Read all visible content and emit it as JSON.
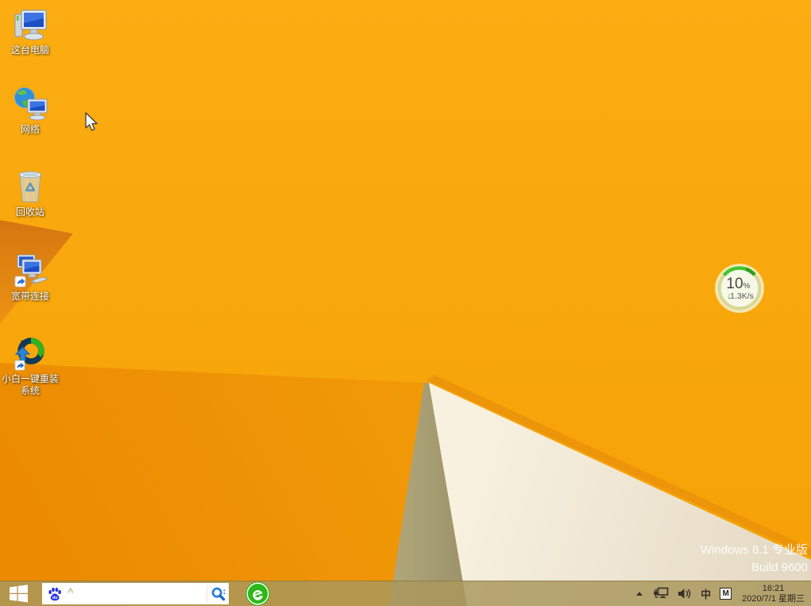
{
  "desktop": {
    "icons": [
      {
        "label": "这台电脑"
      },
      {
        "label": "网络"
      },
      {
        "label": "回收站"
      },
      {
        "label": "宽带连接"
      },
      {
        "label": "小白一键重装系统"
      }
    ],
    "watermark": {
      "line1": "Windows 8.1 专业版",
      "line2": "Build 9600"
    },
    "float_ball": {
      "percent": "10",
      "unit": "%",
      "down_arrow": "↓",
      "speed": "1.3K/s"
    }
  },
  "taskbar": {
    "search": {
      "caret": "^",
      "value": "",
      "placeholder": ""
    },
    "tray": {
      "ime_lang": "中",
      "ime_mode": "M",
      "time": "16:21",
      "date": "2020/7/1 星期三"
    }
  },
  "colors": {
    "wallpaper_base": "#f8a809",
    "wallpaper_fan": "#ee9005",
    "wallpaper_wedge": "#d97c10",
    "wallpaper_khaki": "#a89d72",
    "wallpaper_cream": "#f3ebd7",
    "taskbar_tan": "#b49a58",
    "baidu_blue": "#2932e1",
    "search_blue": "#2a7de1",
    "browser_green": "#2db718",
    "ball_green": "#3dc01e"
  }
}
